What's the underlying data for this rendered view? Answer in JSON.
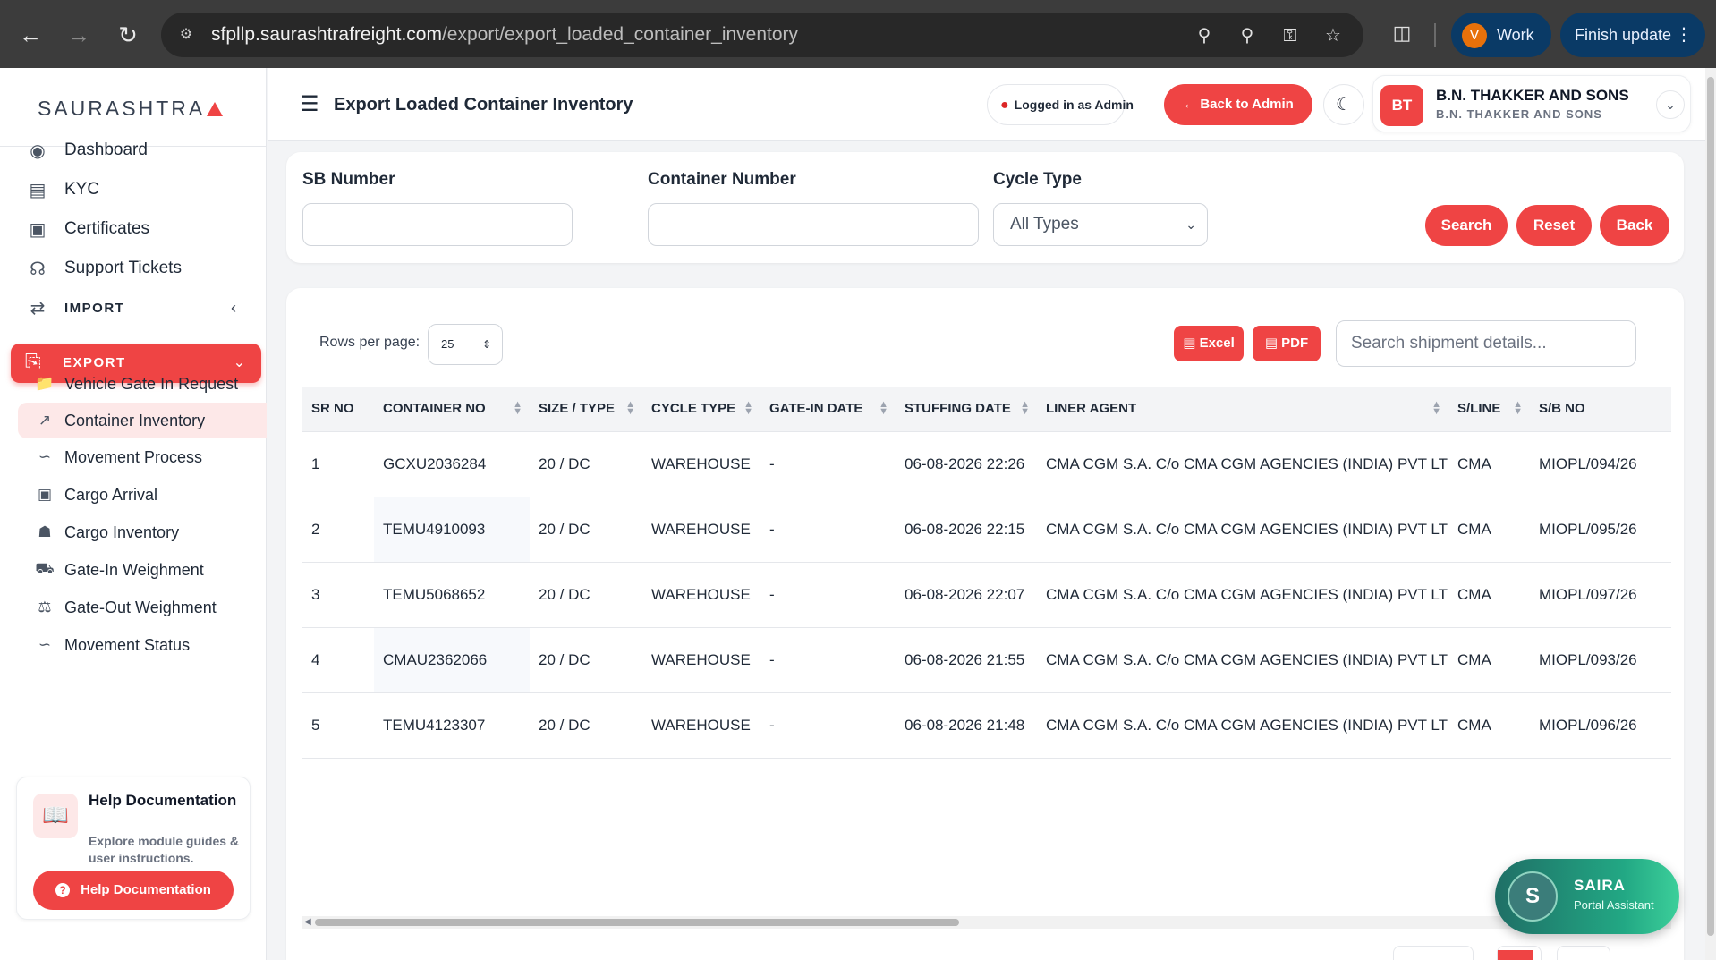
{
  "browser": {
    "url_host": "sfpllp.saurashtrafreight.com",
    "url_path": "/export/export_loaded_container_inventory",
    "profile_initial": "V",
    "profile_label": "Work",
    "update_label": "Finish update"
  },
  "sidebar": {
    "logo": "SAURASHTRA",
    "items": [
      {
        "label": "Dashboard",
        "icon": "palette-icon"
      },
      {
        "label": "KYC",
        "icon": "id-card-icon"
      },
      {
        "label": "Certificates",
        "icon": "certificate-icon"
      },
      {
        "label": "Support Tickets",
        "icon": "headset-icon"
      },
      {
        "label": "IMPORT",
        "icon": "arrows-icon"
      }
    ],
    "export_label": "EXPORT",
    "export_sub": [
      {
        "label": "Vehicle Gate In Request",
        "icon": "folder-icon"
      },
      {
        "label": "Container Inventory",
        "icon": "chart-line-icon"
      },
      {
        "label": "Movement Process",
        "icon": "route-icon"
      },
      {
        "label": "Cargo Arrival",
        "icon": "box-icon"
      },
      {
        "label": "Cargo Inventory",
        "icon": "warehouse-icon"
      },
      {
        "label": "Gate-In Weighment",
        "icon": "truck-icon"
      },
      {
        "label": "Gate-Out Weighment",
        "icon": "scale-icon"
      },
      {
        "label": "Movement Status",
        "icon": "route-icon"
      }
    ],
    "help": {
      "title": "Help Documentation",
      "desc": "Explore module guides & user instructions.",
      "button": "Help Documentation"
    }
  },
  "header": {
    "title": "Export Loaded Container Inventory",
    "admin_chip": "Logged in as Admin",
    "back_admin": "Back to Admin",
    "user_initials": "BT",
    "user_name": "B.N. THAKKER AND SONS",
    "user_sub": "B.N. THAKKER AND SONS"
  },
  "filters": {
    "sb_label": "SB Number",
    "sb_value": "",
    "container_label": "Container Number",
    "container_value": "",
    "cycle_label": "Cycle Type",
    "cycle_value": "All Types",
    "search_btn": "Search",
    "reset_btn": "Reset",
    "back_btn": "Back"
  },
  "table": {
    "rows_label": "Rows per page:",
    "rows_value": "25",
    "excel_btn": "Excel",
    "pdf_btn": "PDF",
    "search_placeholder": "Search shipment details...",
    "columns": [
      "SR NO",
      "CONTAINER NO",
      "SIZE / TYPE",
      "CYCLE TYPE",
      "GATE-IN DATE",
      "STUFFING DATE",
      "LINER AGENT",
      "S/LINE",
      "S/B NO"
    ],
    "rows": [
      [
        "1",
        "GCXU2036284",
        "20 / DC",
        "WAREHOUSE",
        "-",
        "06-08-2026 22:26",
        "CMA CGM S.A. C/o CMA CGM AGENCIES (INDIA) PVT LTD.",
        "CMA",
        "MIOPL/094/26"
      ],
      [
        "2",
        "TEMU4910093",
        "20 / DC",
        "WAREHOUSE",
        "-",
        "06-08-2026 22:15",
        "CMA CGM S.A. C/o CMA CGM AGENCIES (INDIA) PVT LTD.",
        "CMA",
        "MIOPL/095/26"
      ],
      [
        "3",
        "TEMU5068652",
        "20 / DC",
        "WAREHOUSE",
        "-",
        "06-08-2026 22:07",
        "CMA CGM S.A. C/o CMA CGM AGENCIES (INDIA) PVT LTD.",
        "CMA",
        "MIOPL/097/26"
      ],
      [
        "4",
        "CMAU2362066",
        "20 / DC",
        "WAREHOUSE",
        "-",
        "06-08-2026 21:55",
        "CMA CGM S.A. C/o CMA CGM AGENCIES (INDIA) PVT LTD.",
        "CMA",
        "MIOPL/093/26"
      ],
      [
        "5",
        "TEMU4123307",
        "20 / DC",
        "WAREHOUSE",
        "-",
        "06-08-2026 21:48",
        "CMA CGM S.A. C/o CMA CGM AGENCIES (INDIA) PVT LTD.",
        "CMA",
        "MIOPL/096/26"
      ]
    ]
  },
  "assistant": {
    "initial": "S",
    "name": "SAIRA",
    "sub": "Portal Assistant"
  },
  "colors": {
    "accent": "#ef4444",
    "chrome": "#3c3c3c"
  }
}
